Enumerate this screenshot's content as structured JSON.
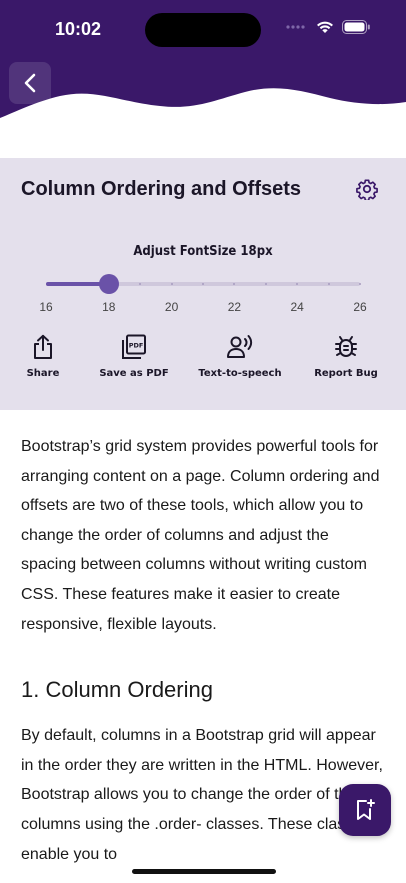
{
  "status_bar": {
    "time": "10:02"
  },
  "colors": {
    "header": "#3a1869",
    "accent": "#6a52a8",
    "panel": "#e4e0ec"
  },
  "header": {
    "back_icon": "chevron-left-icon"
  },
  "tools": {
    "title": "Column Ordering and Offsets",
    "settings_icon": "gear-icon",
    "font_label": "Adjust FontSize 18px",
    "slider": {
      "min": 16,
      "max": 26,
      "value": 18,
      "tick_labels": [
        "16",
        "18",
        "20",
        "22",
        "24",
        "26"
      ]
    },
    "actions": [
      {
        "label": "Share",
        "icon": "share-icon"
      },
      {
        "label": "Save as PDF",
        "icon": "pdf-icon"
      },
      {
        "label": "Text-to-speech",
        "icon": "speaker-icon"
      },
      {
        "label": "Report Bug",
        "icon": "bug-icon"
      }
    ]
  },
  "content": {
    "intro": "Bootstrap’s grid system provides powerful tools for arranging content on a page. Column ordering and offsets are two of these tools, which allow you to change the order of columns and adjust the spacing between columns without writing custom CSS. These features make it easier to create responsive, flexible layouts.",
    "section1_heading": "1. Column Ordering",
    "section1_text": "By default, columns in a Bootstrap grid will appear in the order they are written in the HTML. However, Bootstrap allows you to change the order of the columns using the .order- classes. These classes enable you to"
  },
  "fab": {
    "icon": "bookmark-add-icon"
  }
}
